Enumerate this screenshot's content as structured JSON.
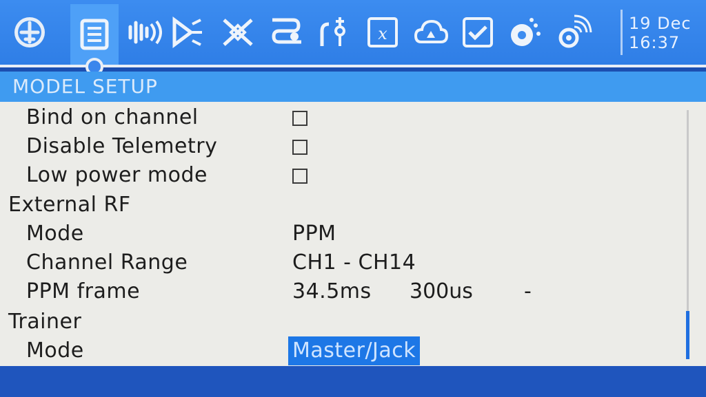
{
  "tabs": [
    {
      "icon": "radio-home-icon",
      "active": false
    },
    {
      "icon": "model-setup-icon",
      "active": true
    },
    {
      "icon": "heli-icon",
      "active": false
    },
    {
      "icon": "flight-modes-icon",
      "active": false
    },
    {
      "icon": "inputs-icon",
      "active": false
    },
    {
      "icon": "mixer-icon",
      "active": false
    },
    {
      "icon": "outputs-icon",
      "active": false
    },
    {
      "icon": "curves-icon",
      "active": false
    },
    {
      "icon": "global-variables-icon",
      "active": false
    },
    {
      "icon": "logical-switches-icon",
      "active": false
    },
    {
      "icon": "special-functions-icon",
      "active": false
    },
    {
      "icon": "lua-scripts-icon",
      "active": false
    },
    {
      "icon": "telemetry-icon",
      "active": false
    }
  ],
  "clock": {
    "date": "19 Dec",
    "time": "16:37"
  },
  "title": "MODEL SETUP",
  "rows": {
    "bind_on_channel": {
      "label": "Bind on channel",
      "checked": false
    },
    "disable_telemetry": {
      "label": "Disable Telemetry",
      "checked": false
    },
    "low_power_mode": {
      "label": "Low power mode",
      "checked": false
    },
    "external_rf": {
      "label": "External RF"
    },
    "ext_mode": {
      "label": "Mode",
      "value": "PPM"
    },
    "channel_range": {
      "label": "Channel Range",
      "value": "CH1 - CH14"
    },
    "ppm_frame": {
      "label": "PPM frame",
      "value1": "34.5ms",
      "value2": "300us",
      "value3": "-"
    },
    "trainer": {
      "label": "Trainer"
    },
    "trainer_mode": {
      "label": "Mode",
      "value": "Master/Jack"
    }
  },
  "colors": {
    "accent": "#3f9bf0",
    "selection": "#1d77e6",
    "background": "#ecece8"
  }
}
